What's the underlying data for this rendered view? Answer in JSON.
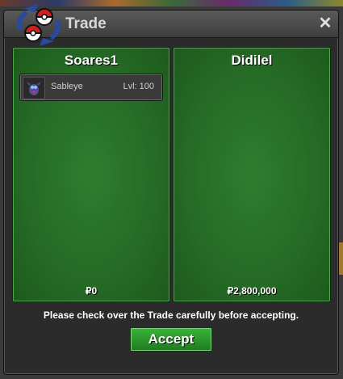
{
  "window": {
    "title": "Trade",
    "close_symbol": "✕"
  },
  "left_panel": {
    "name": "Soares1",
    "money": "₽0",
    "items": [
      {
        "name": "Sableye",
        "level": "Lvl: 100",
        "icon": "sableye-sprite"
      }
    ]
  },
  "right_panel": {
    "name": "Didilel",
    "money": "₽2,800,000"
  },
  "notice": "Please check over the Trade carefully before accepting.",
  "accept_label": "Accept",
  "colors": {
    "panel_green": "#256a25",
    "button_green": "#2a9a2a",
    "titlebar": "#4a4a4a"
  }
}
